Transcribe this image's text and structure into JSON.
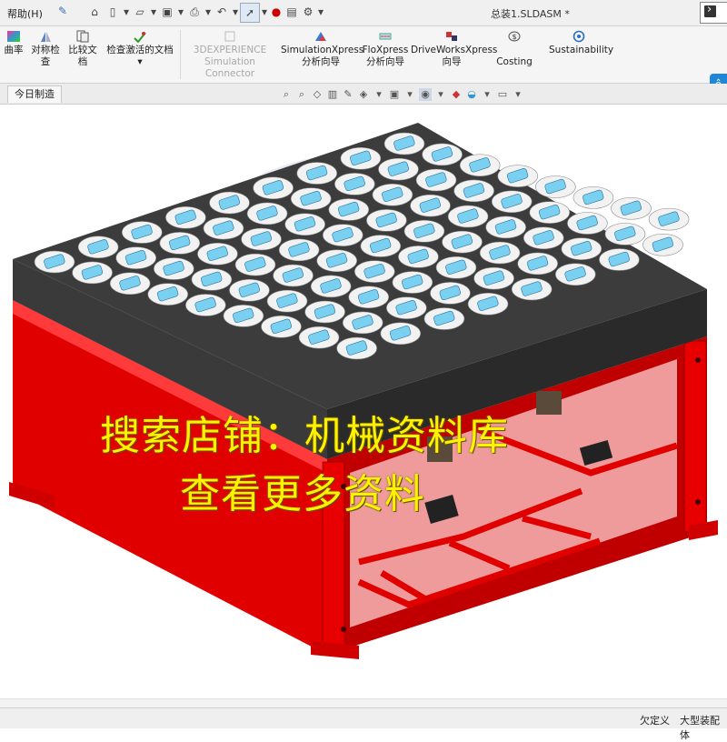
{
  "titlebar": {
    "help_menu": "帮助(H)",
    "document_title": "总装1.SLDASM *"
  },
  "ribbon": {
    "items": [
      {
        "label1": "曲率",
        "label2": "",
        "icon": "curvature-icon"
      },
      {
        "label1": "对称检",
        "label2": "查",
        "icon": "symmetry-check-icon"
      },
      {
        "label1": "比较文",
        "label2": "档",
        "icon": "compare-docs-icon"
      },
      {
        "label1": "检查激活的文档",
        "label2": "",
        "icon": "check-active-doc-icon"
      },
      {
        "label1": "3DEXPERIENCE",
        "label2": "Simulation Connector",
        "icon": "3dexperience-icon",
        "disabled": true
      },
      {
        "label1": "SimulationXpress",
        "label2": "分析向导",
        "icon": "simulationxpress-icon"
      },
      {
        "label1": "FloXpress",
        "label2": "分析向导",
        "icon": "floxpress-icon"
      },
      {
        "label1": "DriveWorksXpress",
        "label2": "向导",
        "icon": "driveworksxpress-icon"
      },
      {
        "label1": "",
        "label2": "Costing",
        "icon": "costing-icon"
      },
      {
        "label1": "Sustainability",
        "label2": "",
        "icon": "sustainability-icon"
      }
    ]
  },
  "tabs": {
    "active": "今日制造"
  },
  "watermark": {
    "line1": "搜索店铺：机械资料库",
    "line2": "查看更多资料"
  },
  "statusbar": {
    "status1": "欠定义",
    "status2": "大型装配体"
  },
  "colors": {
    "frame_red": "#e10000",
    "table_dark": "#3a3a3a",
    "tray_blue": "#7ad0f0",
    "watermark_yellow": "#fff200"
  }
}
